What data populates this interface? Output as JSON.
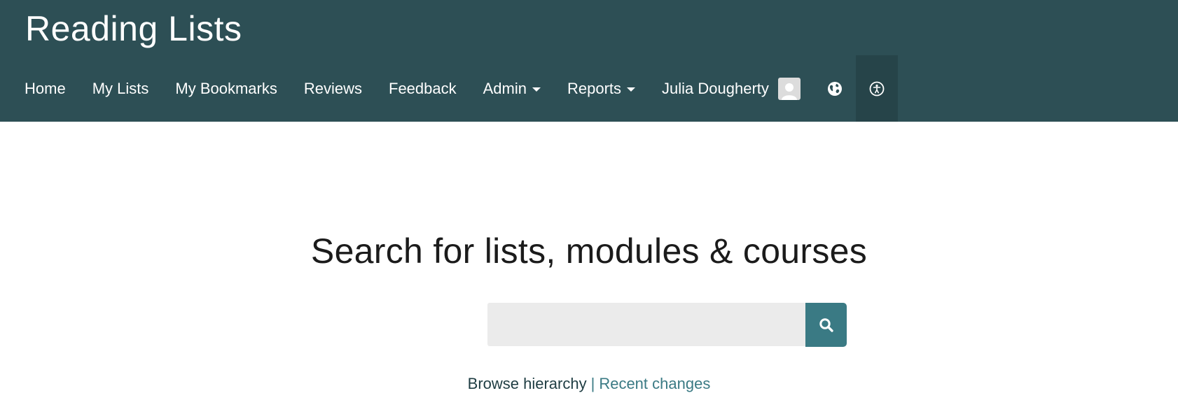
{
  "header": {
    "app_title": "Reading Lists",
    "nav": {
      "home": "Home",
      "my_lists": "My Lists",
      "my_bookmarks": "My Bookmarks",
      "reviews": "Reviews",
      "feedback": "Feedback",
      "admin": "Admin",
      "reports": "Reports",
      "user_name": "Julia Dougherty"
    },
    "icons": {
      "avatar": "avatar-icon",
      "language": "globe-icon",
      "accessibility": "accessibility-icon"
    },
    "colors": {
      "background": "#2d4f55",
      "active_item": "#264449"
    }
  },
  "main": {
    "title": "Search for lists, modules & courses",
    "search": {
      "placeholder": "",
      "value": "",
      "button_icon": "search-icon"
    },
    "links": {
      "browse": "Browse hierarchy",
      "separator": "|",
      "recent": "Recent changes"
    },
    "colors": {
      "accent": "#3a7a84"
    }
  }
}
